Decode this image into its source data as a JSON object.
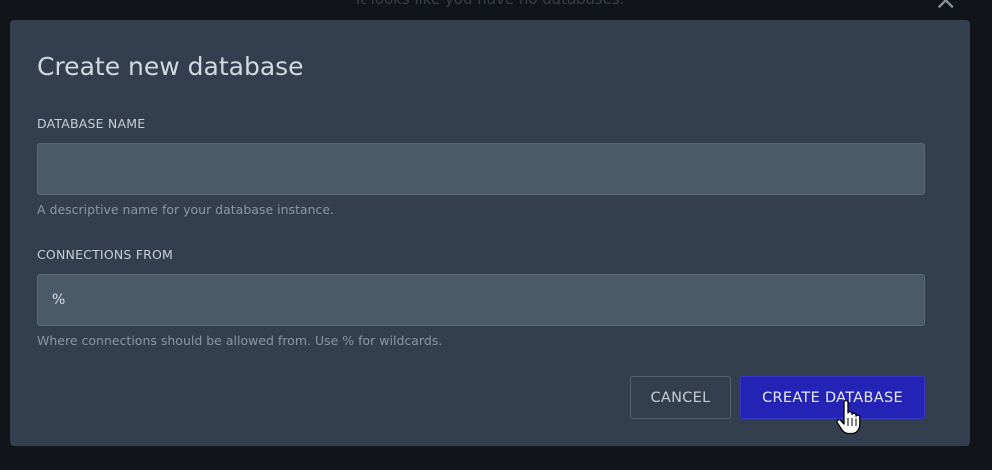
{
  "background": {
    "message": "It looks like you have no databases.",
    "close_glyph": "×"
  },
  "modal": {
    "title": "Create new database",
    "database_name": {
      "label": "DATABASE NAME",
      "value": "",
      "help": "A descriptive name for your database instance."
    },
    "connections_from": {
      "label": "CONNECTIONS FROM",
      "value": "%",
      "help": "Where connections should be allowed from. Use % for wildcards."
    },
    "buttons": {
      "cancel": "CANCEL",
      "create": "CREATE DATABASE"
    }
  },
  "colors": {
    "modal_bg": "#333f4e",
    "input_bg": "#4b5a69",
    "primary_button": "#2323b5"
  },
  "icons": {
    "cursor": "hand-pointer-icon"
  }
}
